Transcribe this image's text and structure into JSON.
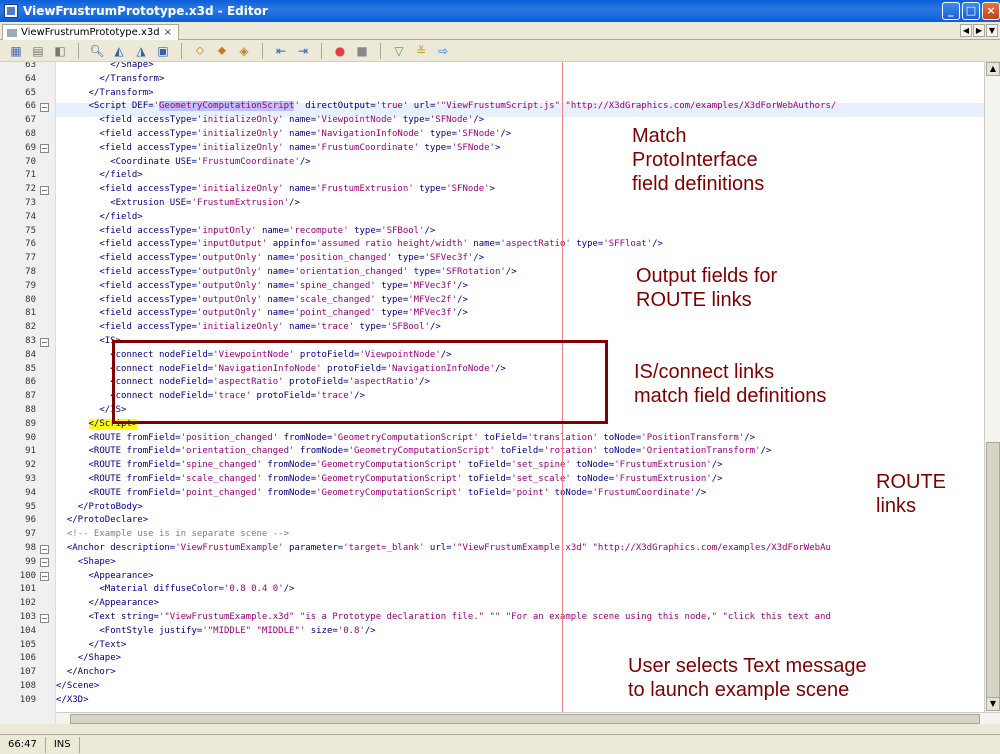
{
  "window": {
    "title": "ViewFrustrumPrototype.x3d - Editor"
  },
  "tab": {
    "label": "ViewFrustrumPrototype.x3d",
    "close": "×"
  },
  "status": {
    "position": "66:47",
    "mode": "INS"
  },
  "annotations": {
    "a1": [
      "Match",
      "ProtoInterface",
      "field definitions"
    ],
    "a2": [
      "Output fields for",
      "ROUTE links"
    ],
    "a3": [
      "IS/connect links",
      "match field definitions"
    ],
    "a4": [
      "ROUTE",
      "links"
    ],
    "a5": [
      "User selects Text message",
      "to launch example scene"
    ]
  },
  "lines": [
    {
      "n": "63",
      "html": "          <span class='t'>&lt;/Shape&gt;</span>"
    },
    {
      "n": "64",
      "html": "        <span class='t'>&lt;/Transform&gt;</span>"
    },
    {
      "n": "65",
      "html": "      <span class='t'>&lt;/Transform&gt;</span>"
    },
    {
      "n": "66",
      "html": "      <span class='t'>&lt;Script</span> <span class='a'>DEF=</span><span class='v'>'<span class='sel'>GeometryComputationScript</span>'</span> <span class='a'>directOutput=</span><span class='v'>'true'</span> <span class='a'>url=</span><span class='v'>'\"ViewFrustumScript.js\" \"http://X3dGraphics.com/examples/X3dForWebAuthors/</span>"
    },
    {
      "n": "67",
      "html": "        <span class='t'>&lt;field</span> <span class='a'>accessType=</span><span class='v'>'initializeOnly'</span> <span class='a'>name=</span><span class='v'>'ViewpointNode'</span> <span class='a'>type=</span><span class='v'>'SFNode'</span><span class='t'>/&gt;</span>"
    },
    {
      "n": "68",
      "html": "        <span class='t'>&lt;field</span> <span class='a'>accessType=</span><span class='v'>'initializeOnly'</span> <span class='a'>name=</span><span class='v'>'NavigationInfoNode'</span> <span class='a'>type=</span><span class='v'>'SFNode'</span><span class='t'>/&gt;</span>"
    },
    {
      "n": "69",
      "html": "        <span class='t'>&lt;field</span> <span class='a'>accessType=</span><span class='v'>'initializeOnly'</span> <span class='a'>name=</span><span class='v'>'FrustumCoordinate'</span> <span class='a'>type=</span><span class='v'>'SFNode'</span><span class='t'>&gt;</span>"
    },
    {
      "n": "70",
      "html": "          <span class='t'>&lt;Coordinate</span> <span class='a'>USE=</span><span class='v'>'FrustumCoordinate'</span><span class='t'>/&gt;</span>"
    },
    {
      "n": "71",
      "html": "        <span class='t'>&lt;/field&gt;</span>"
    },
    {
      "n": "72",
      "html": "        <span class='t'>&lt;field</span> <span class='a'>accessType=</span><span class='v'>'initializeOnly'</span> <span class='a'>name=</span><span class='v'>'FrustumExtrusion'</span> <span class='a'>type=</span><span class='v'>'SFNode'</span><span class='t'>&gt;</span>"
    },
    {
      "n": "73",
      "html": "          <span class='t'>&lt;Extrusion</span> <span class='a'>USE=</span><span class='v'>'FrustumExtrusion'</span><span class='t'>/&gt;</span>"
    },
    {
      "n": "74",
      "html": "        <span class='t'>&lt;/field&gt;</span>"
    },
    {
      "n": "75",
      "html": "        <span class='t'>&lt;field</span> <span class='a'>accessType=</span><span class='v'>'inputOnly'</span> <span class='a'>name=</span><span class='v'>'recompute'</span> <span class='a'>type=</span><span class='v'>'SFBool'</span><span class='t'>/&gt;</span>"
    },
    {
      "n": "76",
      "html": "        <span class='t'>&lt;field</span> <span class='a'>accessType=</span><span class='v'>'inputOutput'</span> <span class='a'>appinfo=</span><span class='v'>'assumed ratio height/width'</span> <span class='a'>name=</span><span class='v'>'aspectRatio'</span> <span class='a'>type=</span><span class='v'>'SFFloat'</span><span class='t'>/&gt;</span>"
    },
    {
      "n": "77",
      "html": "        <span class='t'>&lt;field</span> <span class='a'>accessType=</span><span class='v'>'outputOnly'</span> <span class='a'>name=</span><span class='v'>'position_changed'</span> <span class='a'>type=</span><span class='v'>'SFVec3f'</span><span class='t'>/&gt;</span>"
    },
    {
      "n": "78",
      "html": "        <span class='t'>&lt;field</span> <span class='a'>accessType=</span><span class='v'>'outputOnly'</span> <span class='a'>name=</span><span class='v'>'orientation_changed'</span> <span class='a'>type=</span><span class='v'>'SFRotation'</span><span class='t'>/&gt;</span>"
    },
    {
      "n": "79",
      "html": "        <span class='t'>&lt;field</span> <span class='a'>accessType=</span><span class='v'>'outputOnly'</span> <span class='a'>name=</span><span class='v'>'spine_changed'</span> <span class='a'>type=</span><span class='v'>'MFVec3f'</span><span class='t'>/&gt;</span>"
    },
    {
      "n": "80",
      "html": "        <span class='t'>&lt;field</span> <span class='a'>accessType=</span><span class='v'>'outputOnly'</span> <span class='a'>name=</span><span class='v'>'scale_changed'</span> <span class='a'>type=</span><span class='v'>'MFVec2f'</span><span class='t'>/&gt;</span>"
    },
    {
      "n": "81",
      "html": "        <span class='t'>&lt;field</span> <span class='a'>accessType=</span><span class='v'>'outputOnly'</span> <span class='a'>name=</span><span class='v'>'point_changed'</span> <span class='a'>type=</span><span class='v'>'MFVec3f'</span><span class='t'>/&gt;</span>"
    },
    {
      "n": "82",
      "html": "        <span class='t'>&lt;field</span> <span class='a'>accessType=</span><span class='v'>'initializeOnly'</span> <span class='a'>name=</span><span class='v'>'trace'</span> <span class='a'>type=</span><span class='v'>'SFBool'</span><span class='t'>/&gt;</span>"
    },
    {
      "n": "83",
      "html": "        <span class='t'>&lt;IS&gt;</span>"
    },
    {
      "n": "84",
      "html": "          <span class='t'>&lt;connect</span> <span class='a'>nodeField=</span><span class='v'>'ViewpointNode'</span> <span class='a'>protoField=</span><span class='v'>'ViewpointNode'</span><span class='t'>/&gt;</span>"
    },
    {
      "n": "85",
      "html": "          <span class='t'>&lt;connect</span> <span class='a'>nodeField=</span><span class='v'>'NavigationInfoNode'</span> <span class='a'>protoField=</span><span class='v'>'NavigationInfoNode'</span><span class='t'>/&gt;</span>"
    },
    {
      "n": "86",
      "html": "          <span class='t'>&lt;connect</span> <span class='a'>nodeField=</span><span class='v'>'aspectRatio'</span> <span class='a'>protoField=</span><span class='v'>'aspectRatio'</span><span class='t'>/&gt;</span>"
    },
    {
      "n": "87",
      "html": "          <span class='t'>&lt;connect</span> <span class='a'>nodeField=</span><span class='v'>'trace'</span> <span class='a'>protoField=</span><span class='v'>'trace'</span><span class='t'>/&gt;</span>"
    },
    {
      "n": "88",
      "html": "        <span class='t'>&lt;/IS&gt;</span>"
    },
    {
      "n": "89",
      "html": "      <span class='t yhl'>&lt;/Script&gt;</span>"
    },
    {
      "n": "90",
      "html": "      <span class='t'>&lt;ROUTE</span> <span class='a'>fromField=</span><span class='v'>'position_changed'</span> <span class='a'>fromNode=</span><span class='v'>'GeometryComputationScript'</span> <span class='a'>toField=</span><span class='v'>'translation'</span> <span class='a'>toNode=</span><span class='v'>'PositionTransform'</span><span class='t'>/&gt;</span>"
    },
    {
      "n": "91",
      "html": "      <span class='t'>&lt;ROUTE</span> <span class='a'>fromField=</span><span class='v'>'orientation_changed'</span> <span class='a'>fromNode=</span><span class='v'>'GeometryComputationScript'</span> <span class='a'>toField=</span><span class='v'>'rotation'</span> <span class='a'>toNode=</span><span class='v'>'OrientationTransform'</span><span class='t'>/&gt;</span>"
    },
    {
      "n": "92",
      "html": "      <span class='t'>&lt;ROUTE</span> <span class='a'>fromField=</span><span class='v'>'spine_changed'</span> <span class='a'>fromNode=</span><span class='v'>'GeometryComputationScript'</span> <span class='a'>toField=</span><span class='v'>'set_spine'</span> <span class='a'>toNode=</span><span class='v'>'FrustumExtrusion'</span><span class='t'>/&gt;</span>"
    },
    {
      "n": "93",
      "html": "      <span class='t'>&lt;ROUTE</span> <span class='a'>fromField=</span><span class='v'>'scale_changed'</span> <span class='a'>fromNode=</span><span class='v'>'GeometryComputationScript'</span> <span class='a'>toField=</span><span class='v'>'set_scale'</span> <span class='a'>toNode=</span><span class='v'>'FrustumExtrusion'</span><span class='t'>/&gt;</span>"
    },
    {
      "n": "94",
      "html": "      <span class='t'>&lt;ROUTE</span> <span class='a'>fromField=</span><span class='v'>'point_changed'</span> <span class='a'>fromNode=</span><span class='v'>'GeometryComputationScript'</span> <span class='a'>toField=</span><span class='v'>'point'</span> <span class='a'>toNode=</span><span class='v'>'FrustumCoordinate'</span><span class='t'>/&gt;</span>"
    },
    {
      "n": "95",
      "html": "    <span class='t'>&lt;/ProtoBody&gt;</span>"
    },
    {
      "n": "96",
      "html": "  <span class='t'>&lt;/ProtoDeclare&gt;</span>"
    },
    {
      "n": "97",
      "html": "  <span class='c'>&lt;!-- Example use is in separate scene --&gt;</span>"
    },
    {
      "n": "98",
      "html": "  <span class='t'>&lt;Anchor</span> <span class='a'>description=</span><span class='v'>'ViewFrustumExample'</span> <span class='a'>parameter=</span><span class='v'>'target=_blank'</span> <span class='a'>url=</span><span class='v'>'\"ViewFrustumExample.x3d\" \"http://X3dGraphics.com/examples/X3dForWebAu</span>"
    },
    {
      "n": "99",
      "html": "    <span class='t'>&lt;Shape&gt;</span>"
    },
    {
      "n": "100",
      "html": "      <span class='t'>&lt;Appearance&gt;</span>"
    },
    {
      "n": "101",
      "html": "        <span class='t'>&lt;Material</span> <span class='a'>diffuseColor=</span><span class='v'>'0.8 0.4 0'</span><span class='t'>/&gt;</span>"
    },
    {
      "n": "102",
      "html": "      <span class='t'>&lt;/Appearance&gt;</span>"
    },
    {
      "n": "103",
      "html": "      <span class='t'>&lt;Text</span> <span class='a'>string=</span><span class='v'>'\"ViewFrustumExample.x3d\" \"is a Prototype declaration file.\" \"\" \"For an example scene using this node,\" \"click this text and</span>"
    },
    {
      "n": "104",
      "html": "        <span class='t'>&lt;FontStyle</span> <span class='a'>justify=</span><span class='v'>'\"MIDDLE\" \"MIDDLE\"'</span> <span class='a'>size=</span><span class='v'>'0.8'</span><span class='t'>/&gt;</span>"
    },
    {
      "n": "105",
      "html": "      <span class='t'>&lt;/Text&gt;</span>"
    },
    {
      "n": "106",
      "html": "    <span class='t'>&lt;/Shape&gt;</span>"
    },
    {
      "n": "107",
      "html": "  <span class='t'>&lt;/Anchor&gt;</span>"
    },
    {
      "n": "108",
      "html": "<span class='t'>&lt;/Scene&gt;</span>"
    },
    {
      "n": "109",
      "html": "<span class='t'>&lt;/X3D&gt;</span>"
    }
  ],
  "folds": [
    "66",
    "69",
    "72",
    "83",
    "98",
    "99",
    "100",
    "103"
  ]
}
